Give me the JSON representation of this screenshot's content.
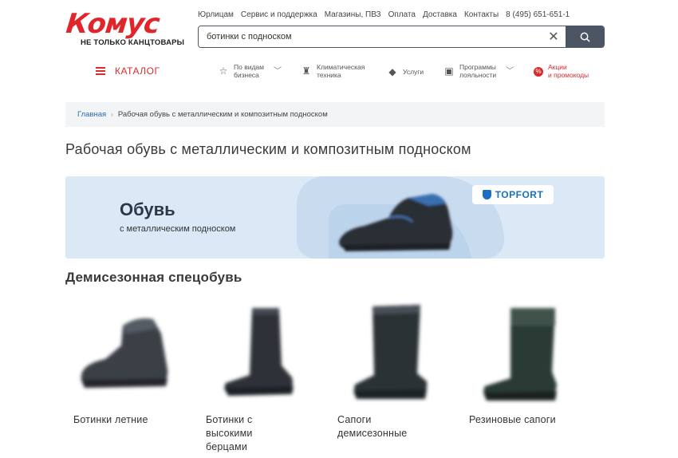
{
  "header": {
    "logo_text": "Комус",
    "logo_tagline": "НЕ ТОЛЬКО КАНЦТОВАРЫ",
    "top_links": [
      "Юрлицам",
      "Сервис и поддержка",
      "Магазины, ПВЗ",
      "Оплата",
      "Доставка",
      "Контакты",
      "8 (495) 651-651-1"
    ],
    "search": {
      "value": "ботинки с подноском",
      "clear_icon": "close-icon",
      "button_icon": "search-icon"
    }
  },
  "nav": {
    "catalog_label": "КАТАЛОГ",
    "items": [
      {
        "icon": "star-icon",
        "label": "По видам бизнеса",
        "line1": "По видам",
        "line2": "бизнеса",
        "dropdown": true
      },
      {
        "icon": "climate-icon",
        "label": "Климатическая техника",
        "line1": "Климатическая",
        "line2": "техника",
        "dropdown": false
      },
      {
        "icon": "services-icon",
        "label": "Услуги",
        "line1": "Услуги",
        "line2": "",
        "dropdown": false
      },
      {
        "icon": "loyalty-icon",
        "label": "Программы лояльности",
        "line1": "Программы",
        "line2": "лояльности",
        "dropdown": true
      },
      {
        "icon": "promo-icon",
        "label": "Акции и промокоды",
        "line1": "Акции",
        "line2": "и промокоды",
        "dropdown": false
      }
    ]
  },
  "breadcrumb": {
    "home": "Главная",
    "current": "Рабочая обувь с металлическим и композитным подноском"
  },
  "page_title": "Рабочая обувь с металлическим и композитным подноском",
  "banner": {
    "title": "Обувь",
    "subtitle": "с металлическим подноском",
    "badge": "TOPFORT"
  },
  "section_title": "Демисезонная спецобувь",
  "products": [
    {
      "name": "Ботинки летние"
    },
    {
      "name": "Ботинки с высокими берцами"
    },
    {
      "name": "Сапоги демисезонные"
    },
    {
      "name": "Резиновые сапоги"
    }
  ],
  "colors": {
    "accent": "#d92b2b",
    "link": "#2b6cb0",
    "search_button": "#4b5563",
    "banner_bg": "#dbe9f6"
  }
}
